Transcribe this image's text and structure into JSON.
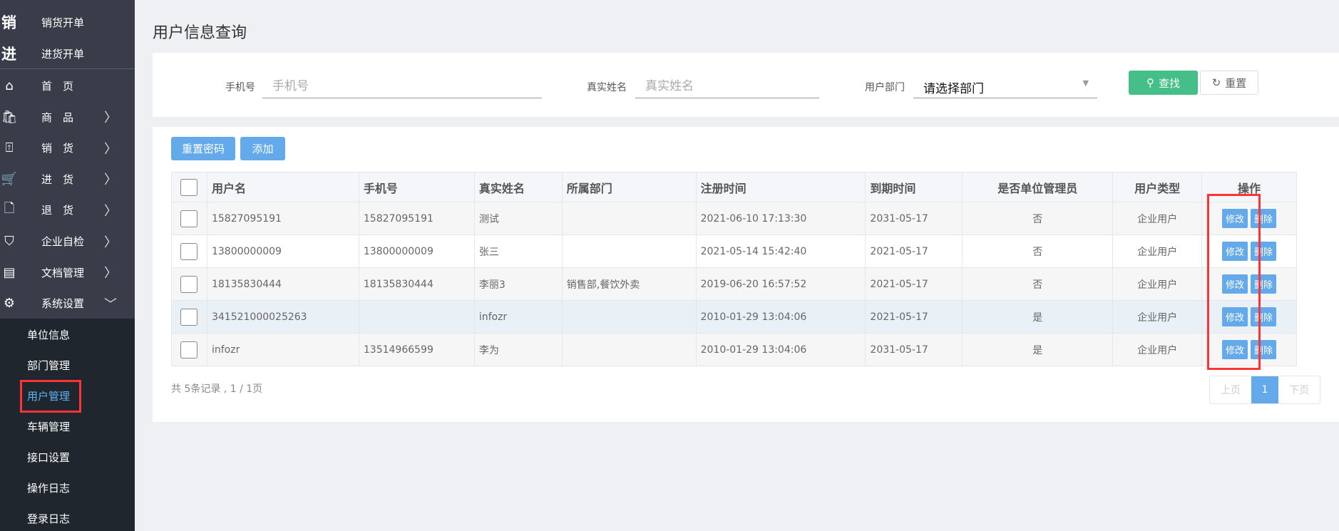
{
  "sidebar": {
    "quick": [
      {
        "glyph": "销",
        "label": "销货开单"
      },
      {
        "glyph": "进",
        "label": "进货开单"
      }
    ],
    "items": [
      {
        "label": "首　页",
        "icon": "home-icon"
      },
      {
        "label": "商　品",
        "icon": "bag-icon"
      },
      {
        "label": "销　货",
        "icon": "upload-icon"
      },
      {
        "label": "进　货",
        "icon": "cart-icon"
      },
      {
        "label": "退　货",
        "icon": "file-return-icon"
      },
      {
        "label": "企业自检",
        "icon": "shield-icon"
      },
      {
        "label": "文档管理",
        "icon": "document-icon"
      },
      {
        "label": "系统设置",
        "icon": "gear-icon"
      }
    ],
    "sub": [
      "单位信息",
      "部门管理",
      "用户管理",
      "车辆管理",
      "接口设置",
      "操作日志",
      "登录日志"
    ]
  },
  "page": {
    "title": "用户信息查询"
  },
  "filters": {
    "phone_label": "手机号",
    "phone_placeholder": "手机号",
    "name_label": "真实姓名",
    "name_placeholder": "真实姓名",
    "dept_label": "用户部门",
    "dept_value": "请选择部门",
    "search": "查找",
    "reset": "重置"
  },
  "toolbar": {
    "reset_password": "重置密码",
    "add": "添加"
  },
  "table": {
    "headers": [
      "用户名",
      "手机号",
      "真实姓名",
      "所属部门",
      "注册时间",
      "到期时间",
      "是否单位管理员",
      "用户类型",
      "操作"
    ],
    "rows": [
      [
        "15827095191",
        "15827095191",
        "测试",
        "",
        "2021-06-10 17:13:30",
        "2031-05-17",
        "否",
        "企业用户"
      ],
      [
        "13800000009",
        "13800000009",
        "张三",
        "",
        "2021-05-14 15:42:40",
        "2021-05-17",
        "否",
        "企业用户"
      ],
      [
        "18135830444",
        "18135830444",
        "李丽3",
        "销售部,餐饮外卖",
        "2019-06-20 16:57:52",
        "2021-05-17",
        "否",
        "企业用户"
      ],
      [
        "341521000025263",
        "",
        "infozr",
        "",
        "2010-01-29 13:04:06",
        "2021-05-17",
        "是",
        "企业用户"
      ],
      [
        "infozr",
        "13514966599",
        "李为",
        "",
        "2010-01-29 13:04:06",
        "2031-05-17",
        "是",
        "企业用户"
      ]
    ],
    "edit": "修改",
    "delete": "删除"
  },
  "pagination": {
    "summary": "共 5条记录 , 1 / 1页",
    "prev": "上页",
    "current": "1",
    "next": "下页"
  }
}
